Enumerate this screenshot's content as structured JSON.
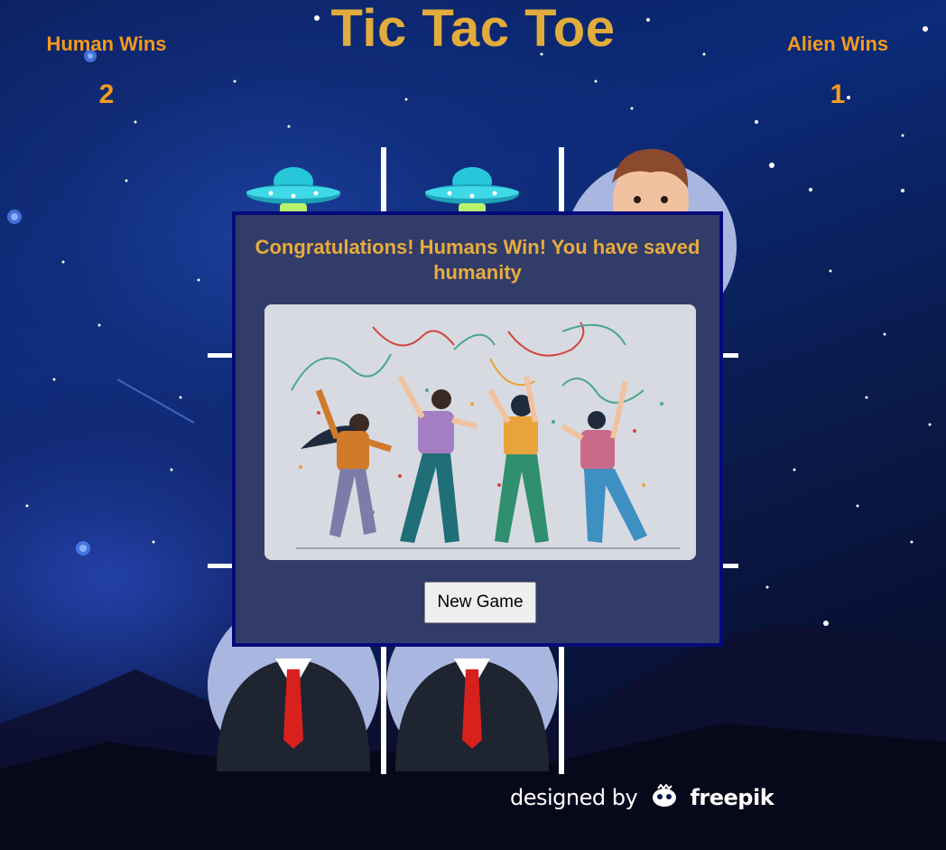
{
  "scoreboard": {
    "human_label": "Human Wins",
    "human_score": "2",
    "alien_label": "Alien Wins",
    "alien_score": "1"
  },
  "game": {
    "title": "Tic Tac Toe",
    "board": [
      [
        "alien",
        "alien",
        "human"
      ],
      [
        "",
        "",
        ""
      ],
      [
        "human",
        "human",
        ""
      ]
    ]
  },
  "modal": {
    "message": "Congratulations! Humans Win! You have saved humanity",
    "new_game_label": "New Game"
  },
  "footer": {
    "credit_prefix": "designed by",
    "credit_brand": "freepik"
  },
  "colors": {
    "accent_orange": "#f39a1c",
    "title_gold": "#e2ac3c",
    "modal_bg": "#323c68",
    "modal_border": "#050a7a"
  }
}
